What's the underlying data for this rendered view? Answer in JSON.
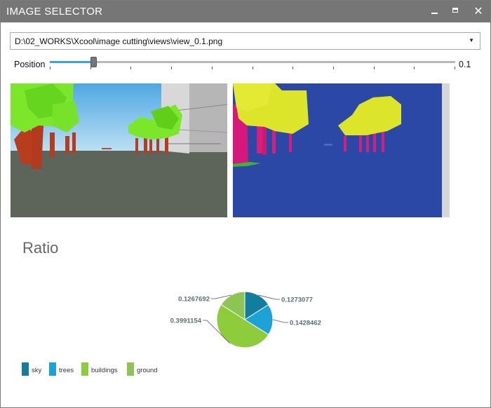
{
  "window": {
    "title": "IMAGE SELECTOR",
    "minimize_icon": "minimize-icon",
    "maximize_icon": "maximize-icon",
    "close_icon": "close-icon",
    "close_glyph": "✕"
  },
  "file_select": {
    "value": "D:\\02_WORKS\\Xcool\\image cutting\\views\\view_0.1.png",
    "arrow_glyph": "▼"
  },
  "position": {
    "label": "Position",
    "value": 0.1,
    "value_label": "0.1",
    "min": 0,
    "max": 1,
    "tick_count": 11
  },
  "images": {
    "left_alt": "rendered view",
    "right_alt": "segmentation view"
  },
  "ratio": {
    "title": "Ratio"
  },
  "colors": {
    "sky": "#127d9c",
    "trees": "#1da2d8",
    "buildings": "#8ecc3c",
    "ground": "#8dc453",
    "accent": "#3da2e0",
    "titlebar": "#767676"
  },
  "chart_data": {
    "type": "pie",
    "title": "Ratio",
    "slices": [
      {
        "name": "sky",
        "value": 0.1273077,
        "label": "0.1273077",
        "color": "#127d9c"
      },
      {
        "name": "trees",
        "value": 0.1428462,
        "label": "0.1428462",
        "color": "#1da2d8"
      },
      {
        "name": "buildings",
        "value": 0.3991154,
        "label": "0.3991154",
        "color": "#8ecc3c"
      },
      {
        "name": "ground",
        "value": 0.1267692,
        "label": "0.1267692",
        "color": "#8dc453"
      }
    ],
    "legend_position": "bottom-left"
  }
}
